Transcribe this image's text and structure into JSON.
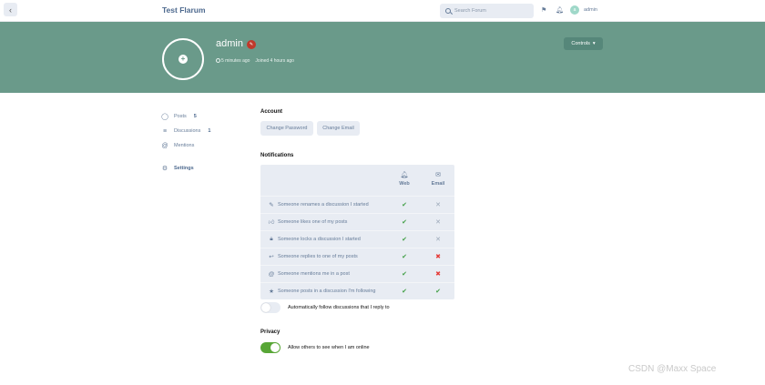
{
  "header": {
    "forum_title": "Test Flarum",
    "search_placeholder": "Search Forum",
    "user_initial": "a",
    "username": "admin"
  },
  "hero": {
    "username": "admin",
    "last_seen": "5 minutes ago",
    "joined": "Joined 4 hours ago",
    "controls_label": "Controls",
    "background": "#6a9a8a"
  },
  "sidebar": {
    "items": [
      {
        "label": "Posts",
        "count": "5",
        "icon": "comment-icon"
      },
      {
        "label": "Discussions",
        "count": "1",
        "icon": "list-icon"
      },
      {
        "label": "Mentions",
        "count": "",
        "icon": "at-icon"
      },
      {
        "label": "Settings",
        "count": "",
        "icon": "gear-icon"
      }
    ]
  },
  "account": {
    "title": "Account",
    "change_password": "Change Password",
    "change_email": "Change Email"
  },
  "notifications": {
    "title": "Notifications",
    "col_web": "Web",
    "col_email": "Email",
    "rows": [
      {
        "label": "Someone renames a discussion I started",
        "icon": "pencil-icon",
        "web": "✔",
        "email": "✕"
      },
      {
        "label": "Someone likes one of my posts",
        "icon": "thumbs-up-icon",
        "web": "✔",
        "email": "✕"
      },
      {
        "label": "Someone locks a discussion I started",
        "icon": "lock-icon",
        "web": "✔",
        "email": "✕"
      },
      {
        "label": "Someone replies to one of my posts",
        "icon": "reply-icon",
        "web": "✔",
        "email": "✖"
      },
      {
        "label": "Someone mentions me in a post",
        "icon": "at-icon",
        "web": "✔",
        "email": "✖"
      },
      {
        "label": "Someone posts in a discussion I'm following",
        "icon": "star-icon",
        "web": "✔",
        "email": "✔"
      }
    ]
  },
  "follow_toggle_label": "Automatically follow discussions that I reply to",
  "privacy": {
    "title": "Privacy",
    "online_label": "Allow others to see when I am online"
  },
  "watermark": "CSDN @Maxx Space"
}
